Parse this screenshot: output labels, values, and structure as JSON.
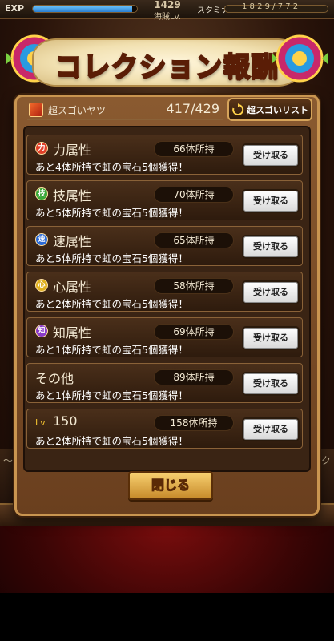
{
  "topbar": {
    "exp_label": "EXP",
    "exp_progress": 0.95,
    "rank_number": "1429",
    "rank_label": "海賊Lv.",
    "stamina_label": "スタミナ",
    "stamina_text": "1 8 2 9 / 7 7 2"
  },
  "dialog": {
    "title": "コレクション報酬",
    "header": {
      "type_name": "超スゴいヤツ",
      "count": "417/429",
      "list_button_label": "超スゴいリスト"
    },
    "rows": [
      {
        "icon": "力",
        "icon_color": "#e0402a",
        "title": "力属性",
        "owned": "66体所持",
        "desc": "あと4体所持で虹の宝石5個獲得！",
        "button": "受け取る"
      },
      {
        "icon": "技",
        "icon_color": "#3aa83a",
        "title": "技属性",
        "owned": "70体所持",
        "desc": "あと5体所持で虹の宝石5個獲得！",
        "button": "受け取る"
      },
      {
        "icon": "速",
        "icon_color": "#2a6ad8",
        "title": "速属性",
        "owned": "65体所持",
        "desc": "あと5体所持で虹の宝石5個獲得！",
        "button": "受け取る"
      },
      {
        "icon": "心",
        "icon_color": "#e0b020",
        "title": "心属性",
        "owned": "58体所持",
        "desc": "あと2体所持で虹の宝石5個獲得！",
        "button": "受け取る"
      },
      {
        "icon": "知",
        "icon_color": "#8a3ac8",
        "title": "知属性",
        "owned": "69体所持",
        "desc": "あと1体所持で虹の宝石5個獲得！",
        "button": "受け取る"
      },
      {
        "icon": "",
        "icon_color": "",
        "title": "その他",
        "owned": "89体所持",
        "desc": "あと1体所持で虹の宝石5個獲得！",
        "button": "受け取る"
      },
      {
        "icon": "",
        "icon_color": "",
        "lv_label": "Lv.",
        "title": "150",
        "owned": "158体所持",
        "desc": "あと2体所持で虹の宝石5個獲得！",
        "button": "受け取る"
      }
    ],
    "close_label": "閉じる"
  },
  "background": {
    "hint_left": "～を",
    "hint_right": "ク"
  }
}
